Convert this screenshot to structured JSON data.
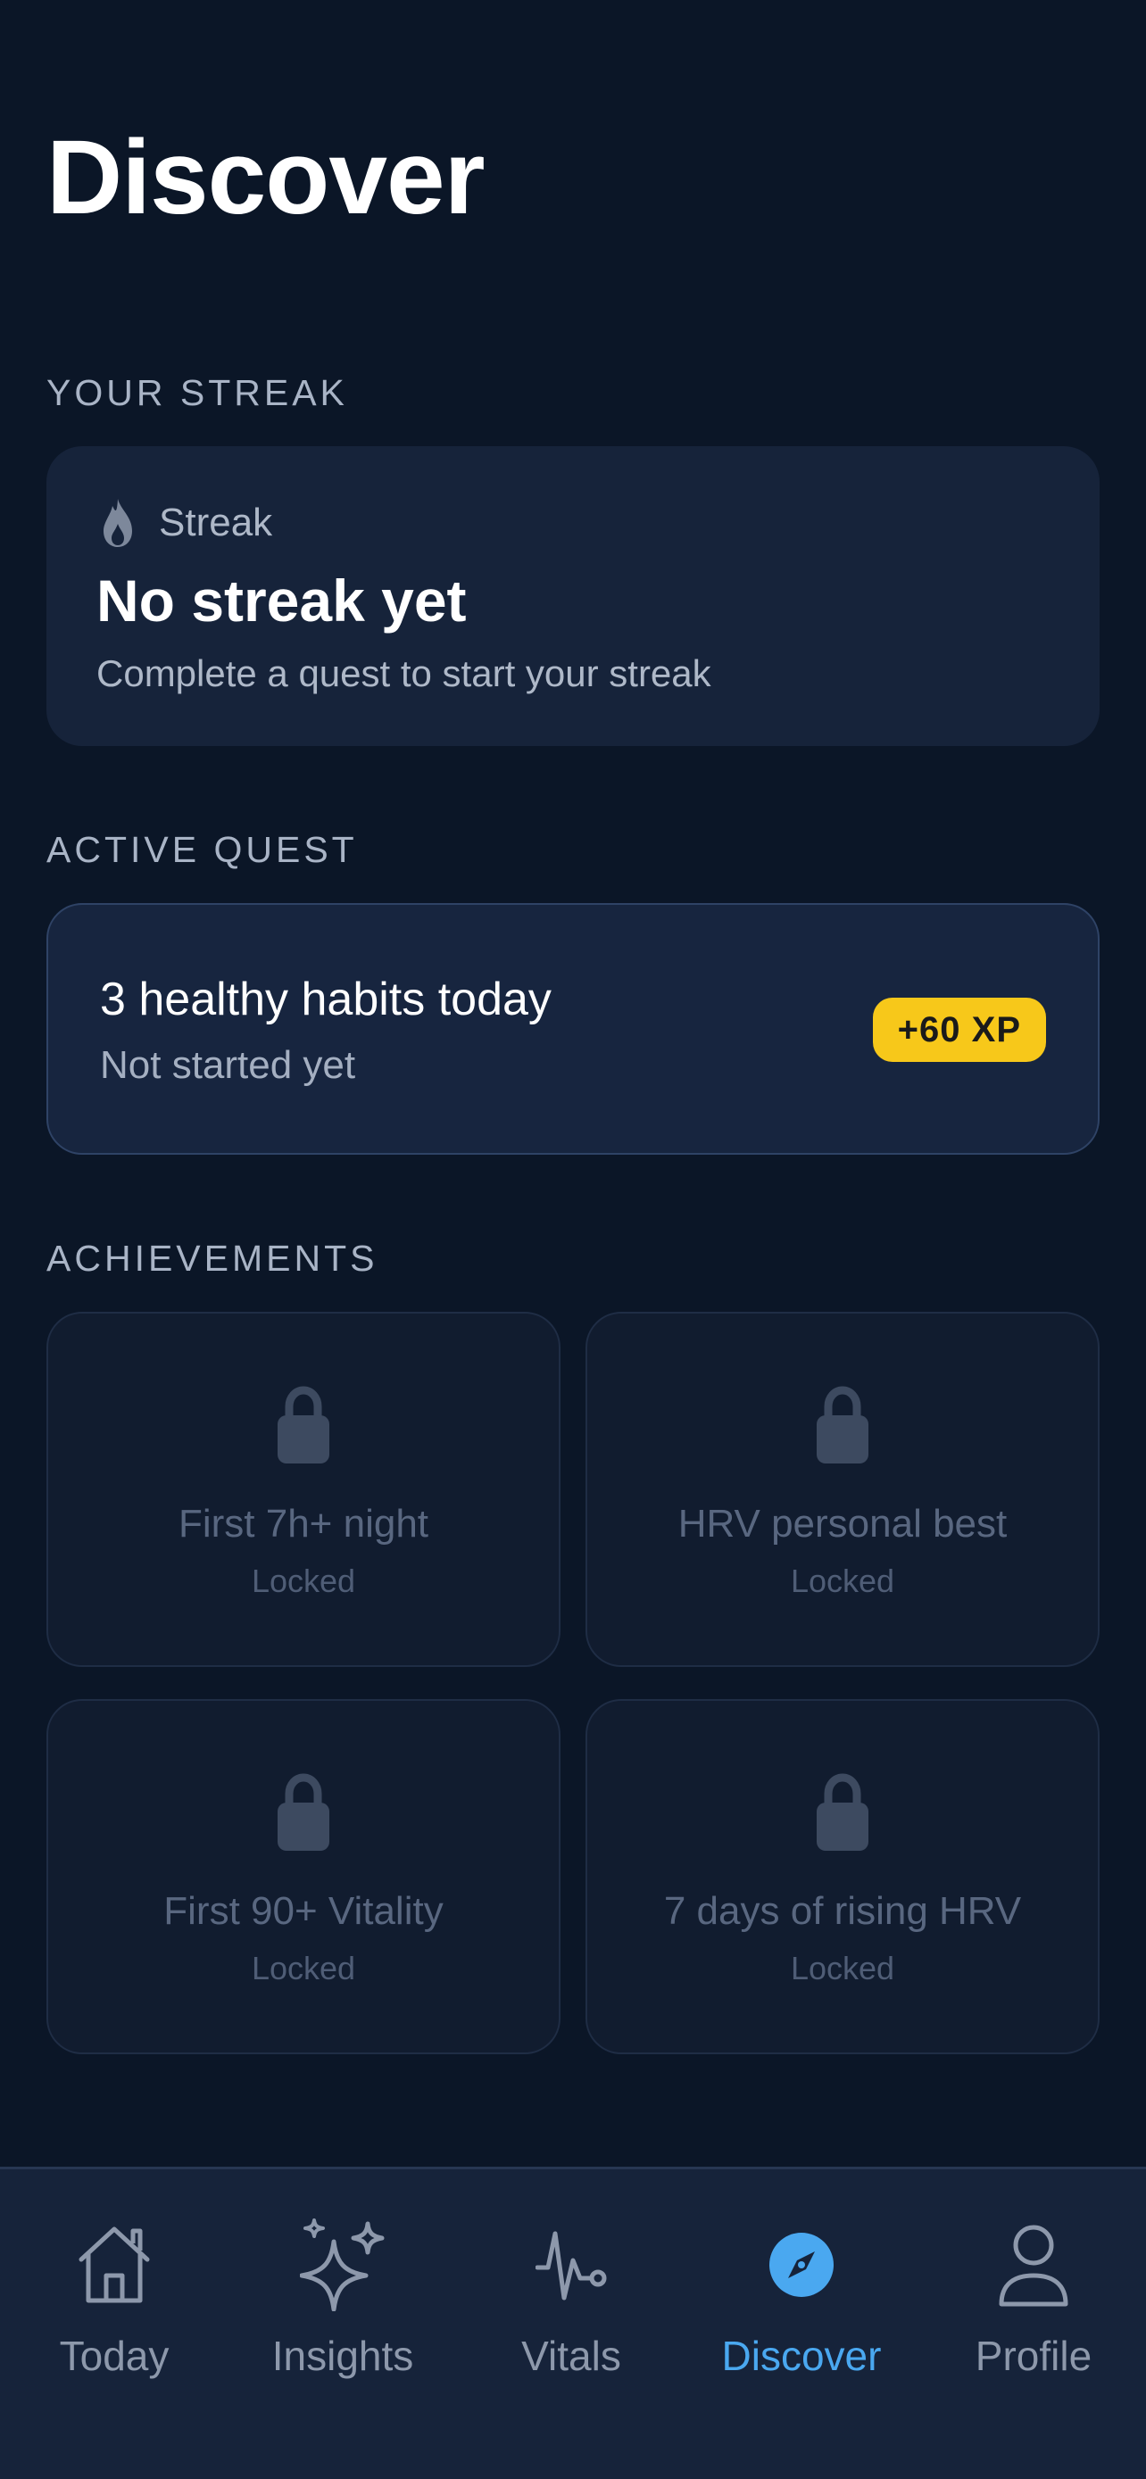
{
  "page": {
    "title": "Discover"
  },
  "streak_section": {
    "label": "YOUR STREAK",
    "card": {
      "icon": "flame-icon",
      "header_label": "Streak",
      "title": "No streak yet",
      "subtitle": "Complete a quest to start your streak"
    }
  },
  "quest_section": {
    "label": "ACTIVE QUEST",
    "card": {
      "title": "3 healthy habits today",
      "status": "Not started yet",
      "reward": "+60 XP"
    }
  },
  "achievements_section": {
    "label": "ACHIEVEMENTS",
    "items": [
      {
        "name": "First 7h+ night",
        "status": "Locked",
        "icon": "lock-icon"
      },
      {
        "name": "HRV personal best",
        "status": "Locked",
        "icon": "lock-icon"
      },
      {
        "name": "First 90+ Vitality",
        "status": "Locked",
        "icon": "lock-icon"
      },
      {
        "name": "7 days of rising HRV",
        "status": "Locked",
        "icon": "lock-icon"
      }
    ]
  },
  "tabbar": {
    "active": "Discover",
    "tabs": [
      {
        "label": "Today",
        "icon": "home-icon"
      },
      {
        "label": "Insights",
        "icon": "sparkles-icon"
      },
      {
        "label": "Vitals",
        "icon": "heartbeat-icon"
      },
      {
        "label": "Discover",
        "icon": "compass-icon"
      },
      {
        "label": "Profile",
        "icon": "person-icon"
      }
    ]
  },
  "colors": {
    "background": "#0b1627",
    "card": "#16233a",
    "accent": "#4aa8f0",
    "xp_badge": "#f7c81a",
    "muted_text": "#a9b4c6"
  }
}
